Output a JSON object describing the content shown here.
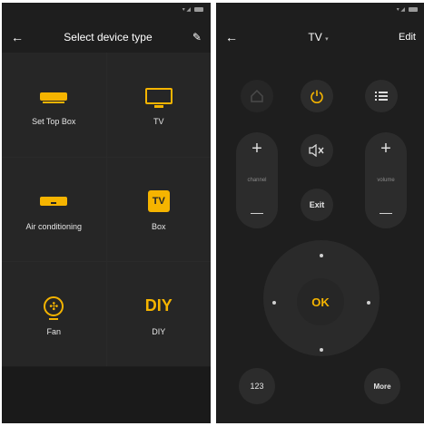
{
  "left_screen": {
    "header": {
      "back_icon": "arrow-left-icon",
      "title": "Select device type",
      "edit_icon": "pencil-icon"
    },
    "tiles": [
      {
        "label": "Set Top Box",
        "icon": "set-top-box-icon"
      },
      {
        "label": "TV",
        "icon": "tv-icon"
      },
      {
        "label": "Air conditioning",
        "icon": "air-conditioner-icon"
      },
      {
        "label": "Box",
        "icon": "box-icon",
        "icon_text": "TV"
      },
      {
        "label": "Fan",
        "icon": "fan-icon"
      },
      {
        "label": "DIY",
        "icon": "diy-icon",
        "icon_text": "DIY"
      }
    ]
  },
  "right_screen": {
    "header": {
      "back_icon": "arrow-left-icon",
      "title": "TV",
      "title_caret": "▾",
      "edit_label": "Edit"
    },
    "buttons": {
      "home_icon": "home-icon",
      "power_icon": "power-icon",
      "menu_icon": "menu-list-icon",
      "channel_label": "channel",
      "volume_label": "volume",
      "plus_symbol": "+",
      "minus_symbol": "—",
      "mute_icon": "mute-icon",
      "exit_label": "Exit",
      "ok_label": "OK",
      "numbers_label": "123",
      "more_label": "More"
    }
  },
  "colors": {
    "accent": "#f5b400",
    "background": "#1e1e1e",
    "button": "#2c2c2c"
  }
}
